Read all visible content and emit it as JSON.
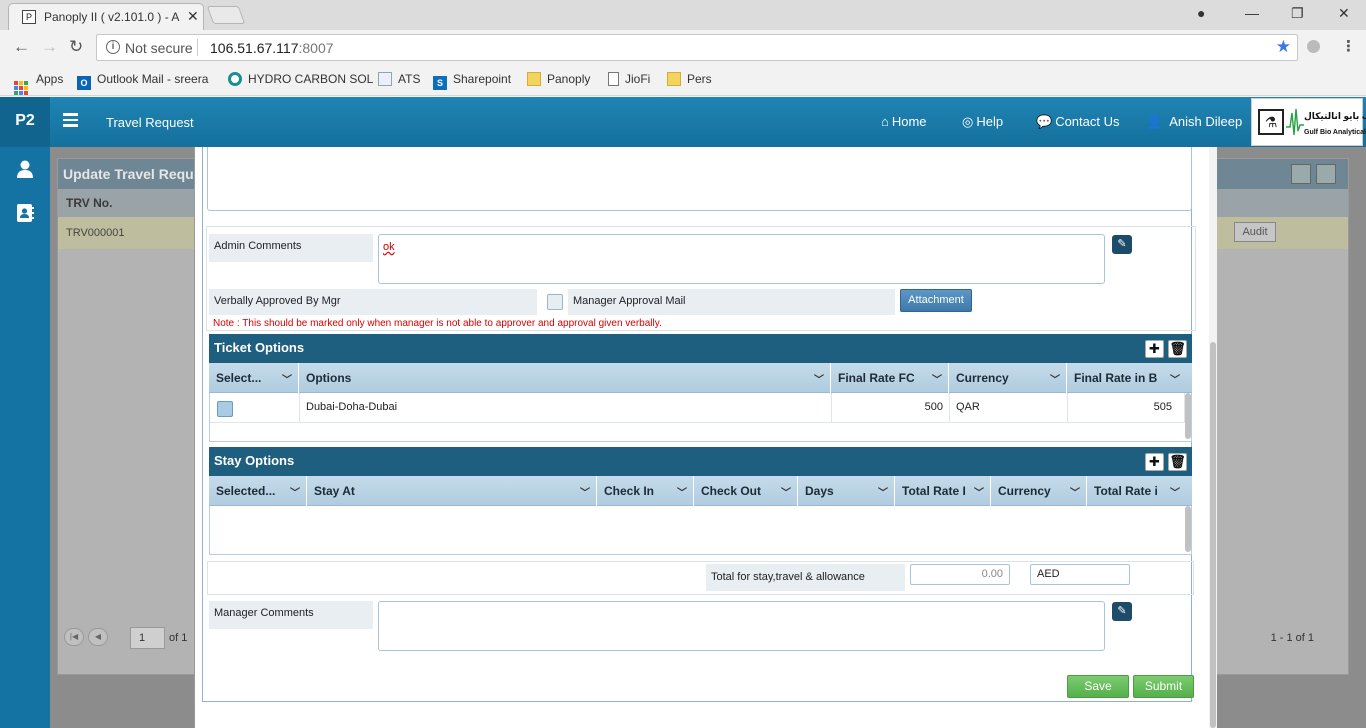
{
  "browser": {
    "tab_title": "Panoply II ( v2.101.0 ) - A",
    "tab_favicon": "P",
    "security_label": "Not secure",
    "url_host": "106.51.67.117",
    "url_port": ":8007",
    "bookmarks": [
      {
        "label": "Apps",
        "icon": "apps-grid-icon"
      },
      {
        "label": "Outlook Mail - sreera",
        "icon": "outlook-icon"
      },
      {
        "label": "HYDRO CARBON SOL",
        "icon": "hydrocarbon-icon"
      },
      {
        "label": "ATS",
        "icon": "document-icon"
      },
      {
        "label": "Sharepoint",
        "icon": "sharepoint-icon"
      },
      {
        "label": "Panoply",
        "icon": "folder-icon"
      },
      {
        "label": "JioFi",
        "icon": "page-icon"
      },
      {
        "label": "Pers",
        "icon": "folder-icon"
      }
    ]
  },
  "header": {
    "brand": "P2",
    "module_title": "Travel Request",
    "nav": {
      "home": "Home",
      "help": "Help",
      "contact": "Contact Us",
      "user": "Anish Dileep"
    },
    "logo_arabic": "جلف بايو انالتيكال",
    "logo_english": "Gulf Bio Analytical"
  },
  "background": {
    "panel_title": "Update Travel Reque",
    "column_header": "TRV No.",
    "row_trv": "TRV000001",
    "audit_label": "Audit",
    "pager_page": "1",
    "pager_of": "of 1",
    "pager_count": "1 - 1 of 1"
  },
  "form": {
    "admin_comments_label": "Admin Comments",
    "admin_comments_value": "ok",
    "verbally_approved_label": "Verbally Approved By Mgr",
    "manager_approval_mail_label": "Manager Approval Mail",
    "attachment_label": "Attachment",
    "note": "Note : This should be marked only when manager is not able to approver and approval given verbally.",
    "total_label": "Total for stay,travel & allowance",
    "total_value": "0.00",
    "total_currency": "AED",
    "manager_comments_label": "Manager Comments",
    "save_label": "Save",
    "submit_label": "Submit"
  },
  "ticket_options": {
    "title": "Ticket Options",
    "columns": [
      "Select...",
      "Options",
      "Final Rate FC",
      "Currency",
      "Final Rate in B"
    ],
    "rows": [
      {
        "option": "Dubai-Doha-Dubai",
        "final_rate_fc": "500",
        "currency": "QAR",
        "final_rate_base": "505"
      }
    ]
  },
  "stay_options": {
    "title": "Stay Options",
    "columns": [
      "Selected...",
      "Stay At",
      "Check In",
      "Check Out",
      "Days",
      "Total Rate I",
      "Currency",
      "Total Rate i"
    ]
  },
  "colors": {
    "header_blue": "#1a7aa8",
    "grid_title": "#1e5f7f",
    "save_green": "#5cb85c",
    "note_red": "#d40000"
  }
}
